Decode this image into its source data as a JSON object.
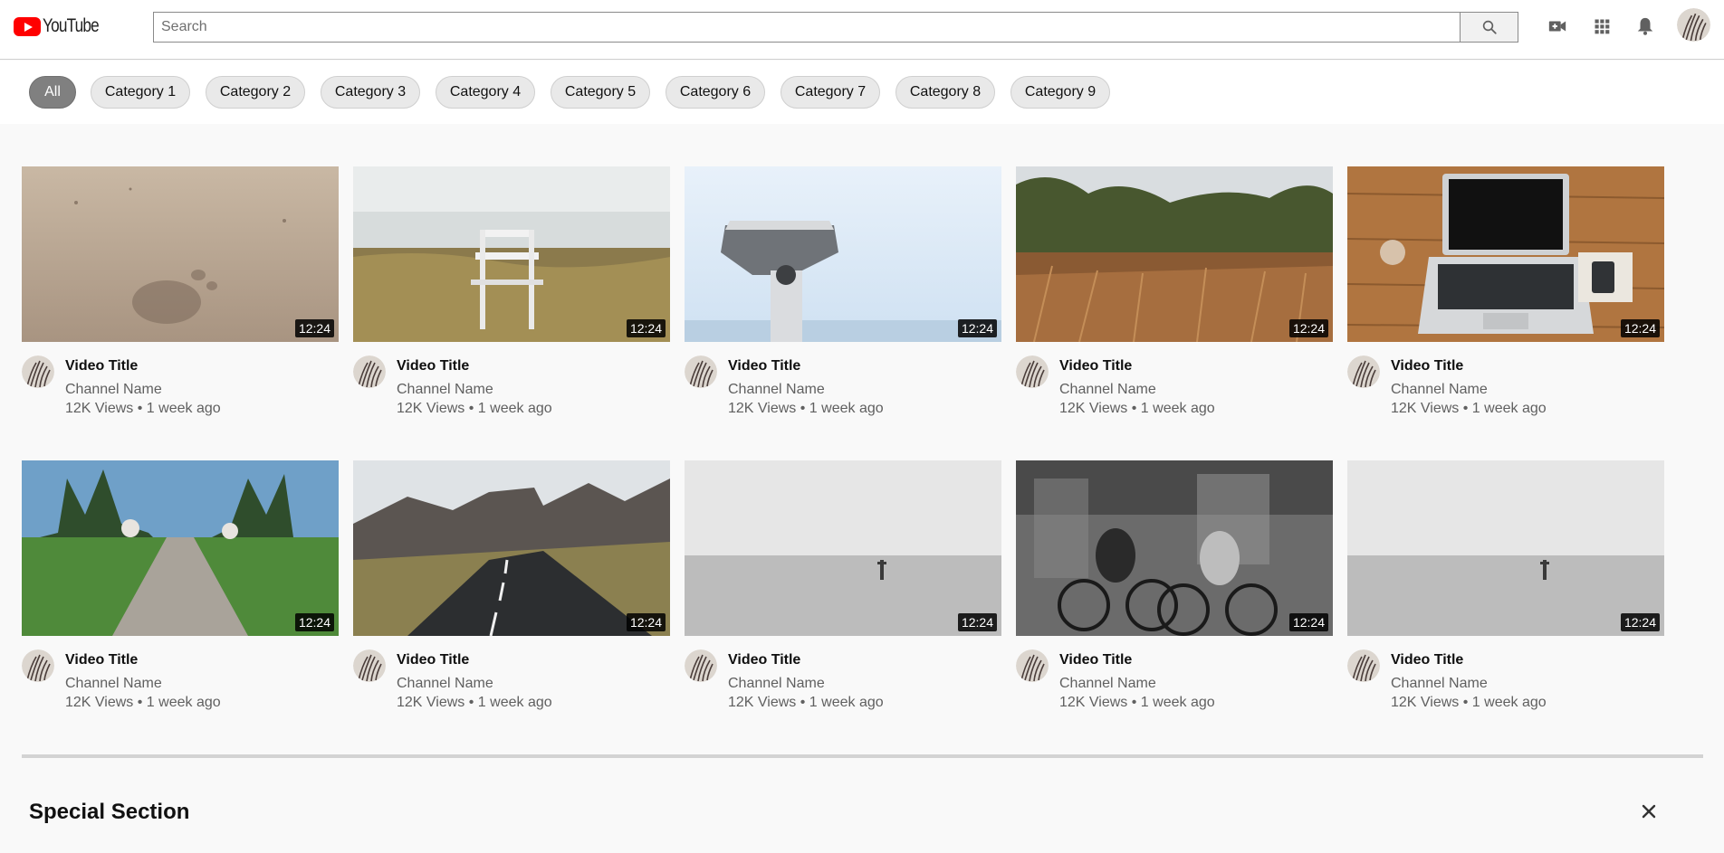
{
  "header": {
    "logo_text": "YouTube",
    "search_placeholder": "Search",
    "search_value": "",
    "icons": [
      "video-camera-icon",
      "apps-grid-icon",
      "bell-icon",
      "avatar"
    ]
  },
  "chips": [
    "All",
    "Category 1",
    "Category 2",
    "Category 3",
    "Category 4",
    "Category 5",
    "Category 6",
    "Category 7",
    "Category 8",
    "Category 9"
  ],
  "active_chip": "All",
  "videos": [
    {
      "title": "Video Title",
      "channel": "Channel Name",
      "stats": "12K Views • 1 week ago",
      "duration": "12:24",
      "thumb": "sand-footprint"
    },
    {
      "title": "Video Title",
      "channel": "Channel Name",
      "stats": "12K Views • 1 week ago",
      "duration": "12:24",
      "thumb": "beach-chair"
    },
    {
      "title": "Video Title",
      "channel": "Channel Name",
      "stats": "12K Views • 1 week ago",
      "duration": "12:24",
      "thumb": "binocular-viewer"
    },
    {
      "title": "Video Title",
      "channel": "Channel Name",
      "stats": "12K Views • 1 week ago",
      "duration": "12:24",
      "thumb": "grass-field"
    },
    {
      "title": "Video Title",
      "channel": "Channel Name",
      "stats": "12K Views • 1 week ago",
      "duration": "12:24",
      "thumb": "laptop-desk"
    },
    {
      "title": "Video Title",
      "channel": "Channel Name",
      "stats": "12K Views • 1 week ago",
      "duration": "12:24",
      "thumb": "forest-path"
    },
    {
      "title": "Video Title",
      "channel": "Channel Name",
      "stats": "12K Views • 1 week ago",
      "duration": "12:24",
      "thumb": "mountain-road"
    },
    {
      "title": "Video Title",
      "channel": "Channel Name",
      "stats": "12K Views • 1 week ago",
      "duration": "12:24",
      "thumb": "foggy-sea"
    },
    {
      "title": "Video Title",
      "channel": "Channel Name",
      "stats": "12K Views • 1 week ago",
      "duration": "12:24",
      "thumb": "cyclists-blur"
    },
    {
      "title": "Video Title",
      "channel": "Channel Name",
      "stats": "12K Views • 1 week ago",
      "duration": "12:24",
      "thumb": "foggy-sea"
    }
  ],
  "special_section": {
    "title": "Special Section",
    "close_icon": "close-icon"
  },
  "colors": {
    "brand_red": "#ff0000",
    "active_chip_bg": "#808080",
    "chip_bg": "#e9e9e9",
    "secondary_text": "#606060"
  }
}
